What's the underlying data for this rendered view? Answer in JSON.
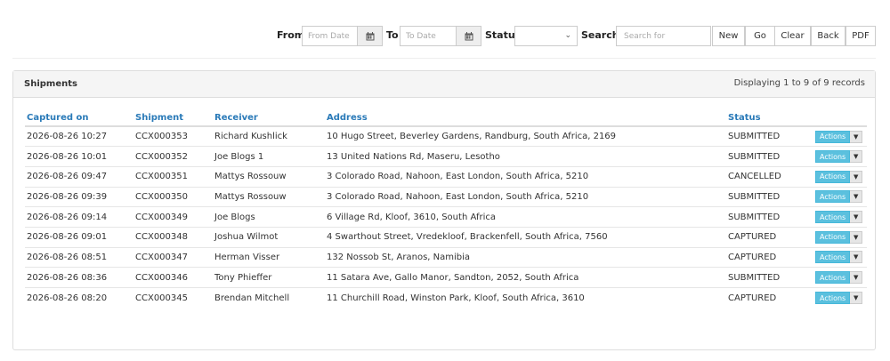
{
  "toolbar": {
    "from_label": "From",
    "from_placeholder": "From Date",
    "to_label": "To",
    "to_placeholder": "To Date",
    "status_label": "Status",
    "status_value": "",
    "search_label": "Search",
    "search_placeholder": "Search for",
    "buttons": {
      "new": "New",
      "go": "Go",
      "clear": "Clear",
      "back": "Back",
      "pdf": "PDF"
    }
  },
  "panel": {
    "title": "Shipments",
    "count_text": "Displaying 1 to 9 of 9 records"
  },
  "table": {
    "headers": [
      "Captured on",
      "Shipment",
      "Receiver",
      "Address",
      "Status"
    ],
    "action_label": "Actions",
    "rows": [
      [
        "2026-08-26 10:27",
        "CCX000353",
        "Richard Kushlick",
        "10 Hugo Street, Beverley Gardens, Randburg, South Africa, 2169",
        "SUBMITTED"
      ],
      [
        "2026-08-26 10:01",
        "CCX000352",
        "Joe Blogs 1",
        "13 United Nations Rd, Maseru, Lesotho",
        "SUBMITTED"
      ],
      [
        "2026-08-26 09:47",
        "CCX000351",
        "Mattys Rossouw",
        "3 Colorado Road, Nahoon, East London, South Africa, 5210",
        "CANCELLED"
      ],
      [
        "2026-08-26 09:39",
        "CCX000350",
        "Mattys Rossouw",
        "3 Colorado Road, Nahoon, East London, South Africa, 5210",
        "SUBMITTED"
      ],
      [
        "2026-08-26 09:14",
        "CCX000349",
        "Joe Blogs",
        "6 Village Rd, Kloof, 3610, South Africa",
        "SUBMITTED"
      ],
      [
        "2026-08-26 09:01",
        "CCX000348",
        "Joshua Wilmot",
        "4 Swarthout Street, Vredekloof, Brackenfell, South Africa, 7560",
        "CAPTURED"
      ],
      [
        "2026-08-26 08:51",
        "CCX000347",
        "Herman Visser",
        "132 Nossob St, Aranos, Namibia",
        "CAPTURED"
      ],
      [
        "2026-08-26 08:36",
        "CCX000346",
        "Tony Phieffer",
        "11 Satara Ave, Gallo Manor, Sandton, 2052, South Africa",
        "SUBMITTED"
      ],
      [
        "2026-08-26 08:20",
        "CCX000345",
        "Brendan Mitchell",
        "11 Churchill Road, Winston Park, Kloof, South Africa, 3610",
        "CAPTURED"
      ]
    ]
  },
  "icons": {
    "calendar": "calendar-icon",
    "chevron": "chevron-down-icon",
    "caret": "caret-down-icon"
  },
  "colors": {
    "header_link": "#2a7ab8",
    "actions_button": "#5bc0de"
  }
}
